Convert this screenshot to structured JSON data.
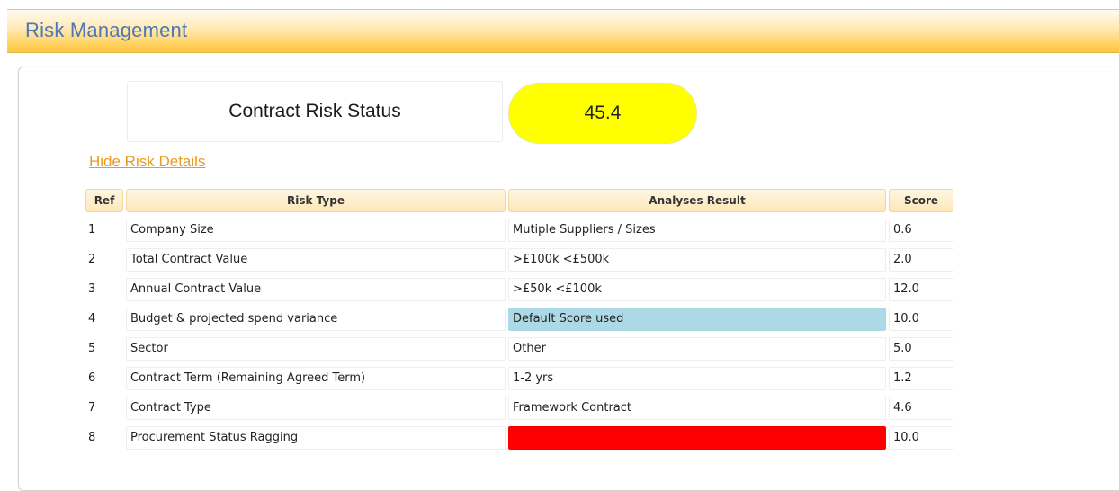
{
  "header": {
    "title": "Risk Management"
  },
  "status": {
    "label": "Contract Risk Status",
    "score": "45.4",
    "score_color": "#ffff00"
  },
  "toggle_link": "Hide Risk Details",
  "table": {
    "headers": {
      "ref": "Ref",
      "risk_type": "Risk Type",
      "result": "Analyses Result",
      "score": "Score"
    },
    "rows": [
      {
        "ref": "1",
        "risk_type": "Company Size",
        "result": "Mutiple Suppliers / Sizes",
        "score": "0.6",
        "highlight": ""
      },
      {
        "ref": "2",
        "risk_type": "Total Contract Value",
        "result": ">£100k <£500k",
        "score": "2.0",
        "highlight": ""
      },
      {
        "ref": "3",
        "risk_type": "Annual Contract Value",
        "result": ">£50k <£100k",
        "score": "12.0",
        "highlight": ""
      },
      {
        "ref": "4",
        "risk_type": "Budget & projected spend variance",
        "result": "Default Score used",
        "score": "10.0",
        "highlight": "#add8e6"
      },
      {
        "ref": "5",
        "risk_type": "Sector",
        "result": "Other",
        "score": "5.0",
        "highlight": ""
      },
      {
        "ref": "6",
        "risk_type": "Contract Term (Remaining Agreed Term)",
        "result": "1-2 yrs",
        "score": "1.2",
        "highlight": ""
      },
      {
        "ref": "7",
        "risk_type": "Contract Type",
        "result": "Framework Contract",
        "score": "4.6",
        "highlight": ""
      },
      {
        "ref": "8",
        "risk_type": "Procurement Status Ragging",
        "result": "",
        "score": "10.0",
        "highlight": "#ff0000"
      }
    ]
  }
}
